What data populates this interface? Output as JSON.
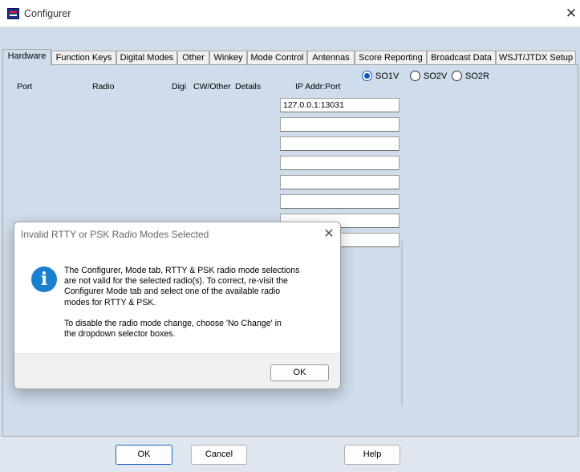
{
  "window": {
    "title": "Configurer",
    "close_glyph": "✕"
  },
  "tabs": [
    {
      "label": "Hardware",
      "active": true
    },
    {
      "label": "Function Keys"
    },
    {
      "label": "Digital Modes"
    },
    {
      "label": "Other"
    },
    {
      "label": "Winkey"
    },
    {
      "label": "Mode Control"
    },
    {
      "label": "Antennas"
    },
    {
      "label": "Score Reporting"
    },
    {
      "label": "Broadcast Data"
    },
    {
      "label": "WSJT/JTDX Setup"
    }
  ],
  "columns": {
    "port": "Port",
    "radio": "Radio",
    "digi": "Digi",
    "cw_other": "CW/Other",
    "details": "Details",
    "ip_addr": "IP Addr:Port"
  },
  "radios": [
    {
      "label": "SO1V",
      "checked": true
    },
    {
      "label": "SO2V",
      "checked": false
    },
    {
      "label": "SO2R",
      "checked": false
    }
  ],
  "ip_fields": [
    "127.0.0.1:13031",
    "",
    "",
    "",
    "",
    "",
    "",
    ""
  ],
  "buttons": {
    "ok": "OK",
    "cancel": "Cancel",
    "help": "Help"
  },
  "dialog": {
    "title": "Invalid RTTY or PSK Radio Modes Selected",
    "close_glyph": "✕",
    "icon": "info-icon",
    "message": "The Configurer, Mode tab, RTTY & PSK radio mode selections\nare not valid for the selected radio(s). To correct, re-visit the\nConfigurer Mode tab and select one of the available radio\nmodes for RTTY & PSK.\n\nTo disable the radio mode change, choose  'No Change' in\nthe dropdown selector boxes.",
    "ok_label": "OK"
  },
  "colors": {
    "background": "#cfdcec",
    "accent": "#1f66c8",
    "info_blue": "#1b7fd0"
  }
}
